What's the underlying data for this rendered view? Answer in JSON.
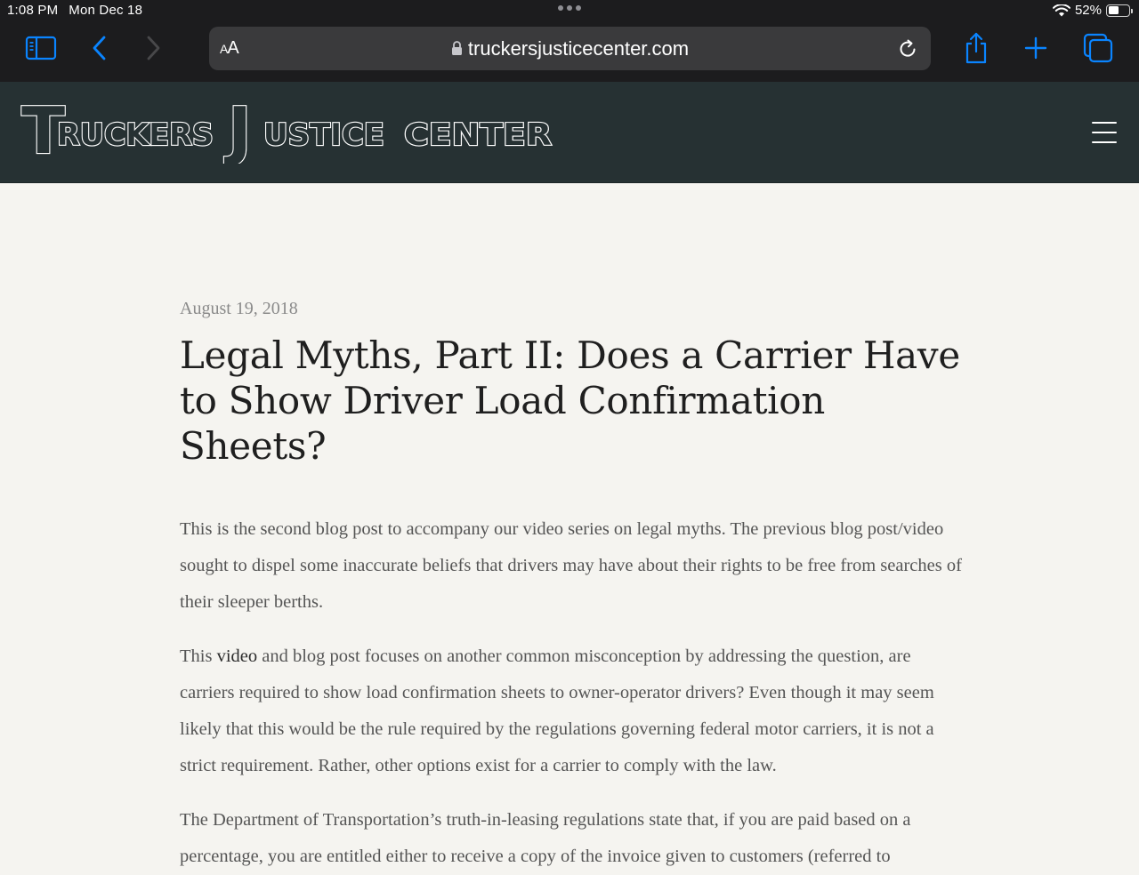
{
  "status_bar": {
    "time": "1:08 PM",
    "date": "Mon Dec 18",
    "battery_percent": "52%",
    "battery_level": 0.52
  },
  "browser": {
    "text_size_label_small": "A",
    "text_size_label_large": "A",
    "url": "truckersjusticecenter.com",
    "icons": {
      "sidebar": "sidebar-icon",
      "back": "chevron-left-icon",
      "forward": "chevron-right-icon",
      "lock": "lock-icon",
      "reload": "reload-icon",
      "share": "share-icon",
      "new_tab": "plus-icon",
      "tabs": "tabs-icon"
    },
    "accent_color": "#0a84ff"
  },
  "site": {
    "logo": {
      "word1_initial": "T",
      "word1_rest": "RUCKERS",
      "word2_initial": "J",
      "word2_rest": "USTICE",
      "word3": "CENTER"
    },
    "header_color": "#263133",
    "menu_icon": "hamburger-menu-icon"
  },
  "article": {
    "date": "August 19, 2018",
    "title": "Legal Myths, Part II: Does a Carrier Have to Show Driver Load Confirmation Sheets?",
    "paragraph1": "This is the second blog post to accompany our video series on legal myths. The previous blog post/video sought to dispel some inaccurate beliefs that drivers may have about their rights to be free from searches of their sleeper berths.",
    "paragraph2_before_link": "This ",
    "paragraph2_link": "video",
    "paragraph2_after_link": " and blog post focuses on another common misconception by addressing the question, are carriers required to show load confirmation sheets to owner-operator drivers? Even though it may seem likely that this would be the rule required by the regulations governing federal motor carriers, it is not a strict requirement. Rather, other options exist for a carrier to comply with the law.",
    "paragraph3": "The Department of Transportation’s truth-in-leasing regulations state that, if you are paid based on a percentage, you are entitled either to receive a copy of the invoice given to customers (referred to"
  }
}
